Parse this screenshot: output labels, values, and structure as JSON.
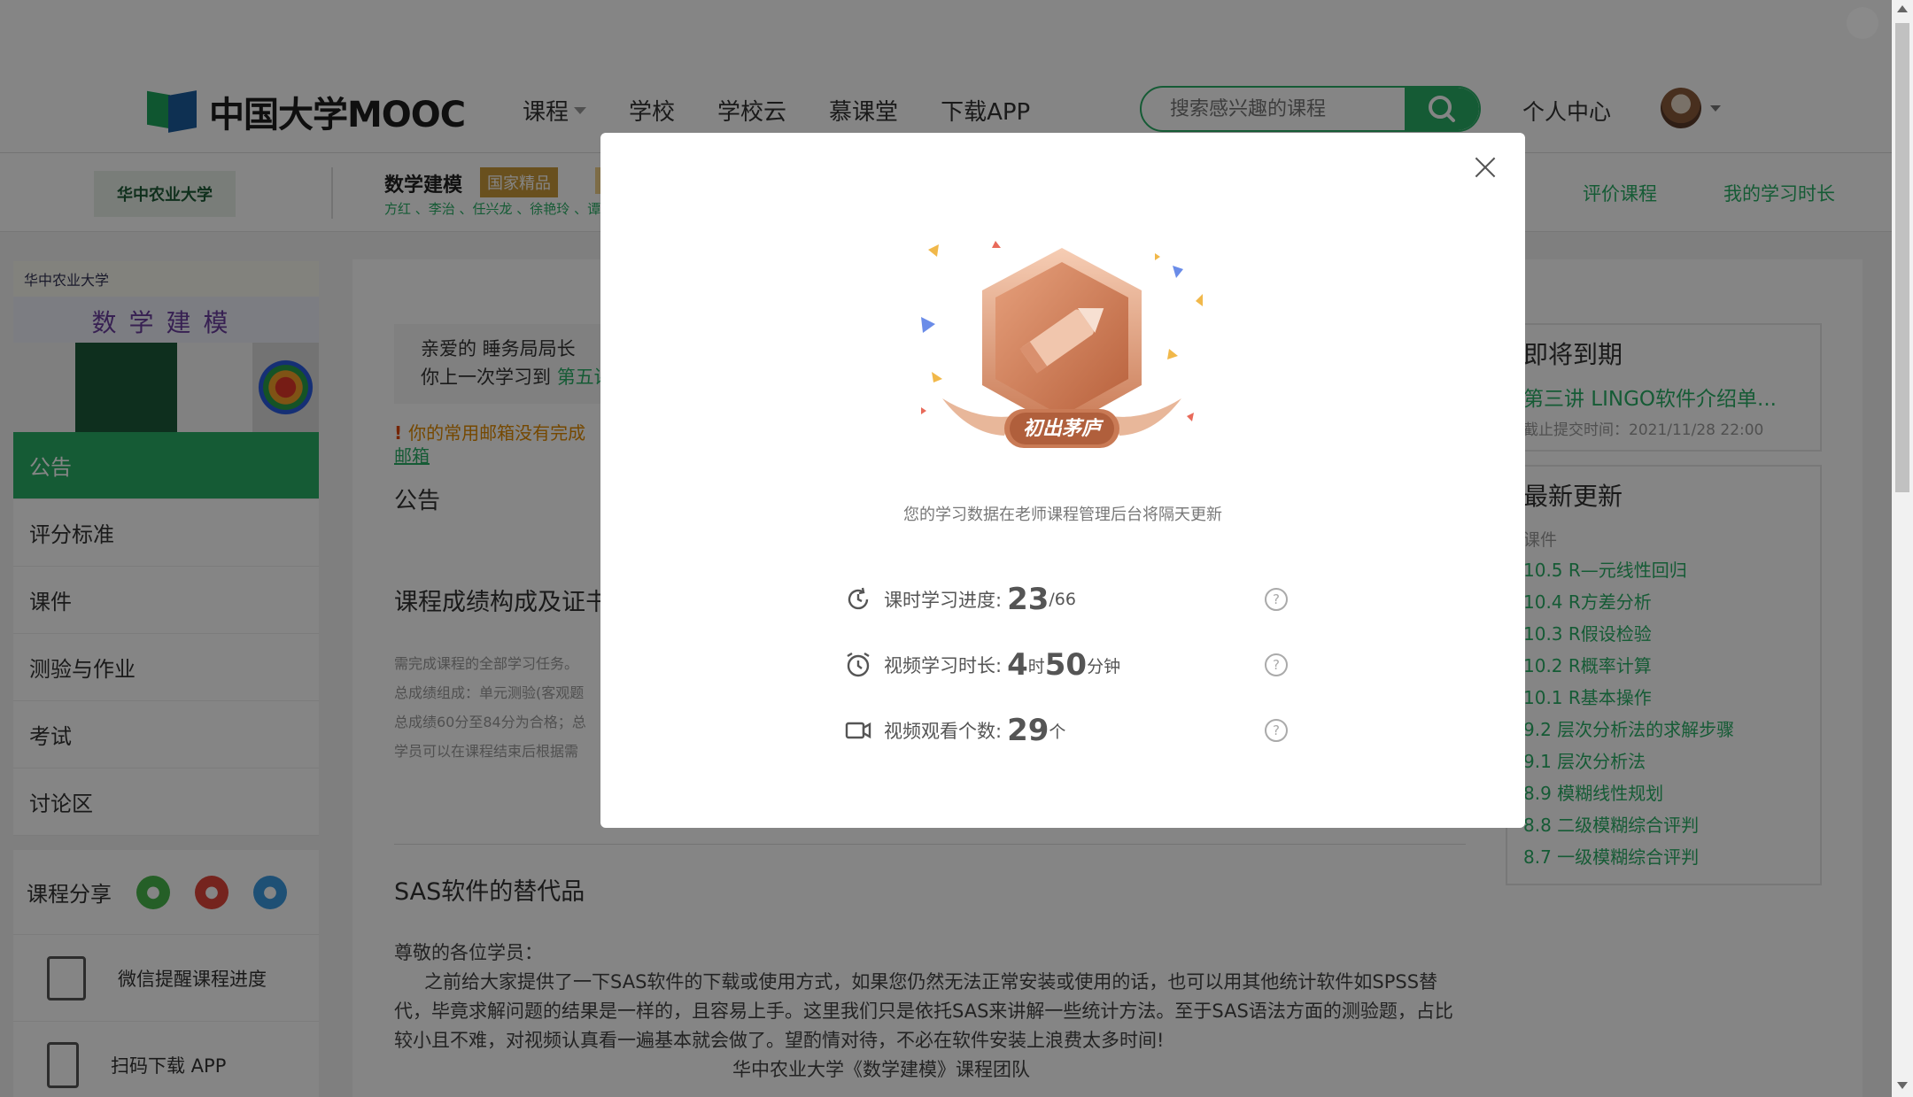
{
  "header": {
    "logo_text": "中国大学MOOC",
    "nav": [
      "课程",
      "学校",
      "学校云",
      "慕课堂",
      "下载APP"
    ],
    "search_placeholder": "搜索感兴趣的课程",
    "personal_center": "个人中心"
  },
  "course_bar": {
    "school_logo_text": "华中农业大学",
    "course_name": "数学建模",
    "badge": "国家精品",
    "teachers": "方红 、李治 、任兴龙 、徐艳玲 、谭",
    "link_rate": "评价课程",
    "link_time": "我的学习时长"
  },
  "sidebar": {
    "banner_school": "华中农业大学",
    "banner_title": "数学建模",
    "menu": [
      "公告",
      "评分标准",
      "课件",
      "测验与作业",
      "考试",
      "讨论区"
    ],
    "share_label": "课程分享",
    "tools": [
      "微信提醒课程进度",
      "扫码下载 APP"
    ]
  },
  "main": {
    "welcome_line1": "亲爱的 睡务局局长",
    "welcome_line2_prefix": "你上一次学习到",
    "welcome_line2_link": "第五讲",
    "warning": "你的常用邮箱没有完成",
    "mail_link": "邮箱",
    "section_announce": "公告",
    "section_grading": "课程成绩构成及证书",
    "rules": [
      "需完成课程的全部学习任务。",
      "总成绩组成：单元测验(客观题",
      "总成绩60分至84分为合格；总",
      "学员可以在课程结束后根据需"
    ],
    "section_sas": "SAS软件的替代品",
    "notice_greeting": "尊敬的各位学员：",
    "notice_body": "之前给大家提供了一下SAS软件的下载或使用方式，如果您仍然无法正常安装或使用的话，也可以用其他统计软件如SPSS替代，毕竟求解问题的结果是一样的，且容易上手。这里我们只是依托SAS来讲解一些统计方法。至于SAS语法方面的测验题，占比较小且不难，对视频认真看一遍基本就会做了。望酌情对待，不必在软件安装上浪费太多时间!",
    "notice_sign": "华中农业大学《数学建模》课程团队"
  },
  "right": {
    "due_title": "即将到期",
    "due_item": "第三讲 LINGO软件介绍单...",
    "due_time": "截止提交时间：2021/11/28 22:00",
    "update_title": "最新更新",
    "update_category": "课件",
    "updates": [
      "10.5 R—元线性回归",
      "10.4 R方差分析",
      "10.3 R假设检验",
      "10.2 R概率计算",
      "10.1 R基本操作",
      "9.2 层次分析法的求解步骤",
      "9.1 层次分析法",
      "8.9 模糊线性规划",
      "8.8 二级模糊综合评判",
      "8.7 一级模糊综合评判"
    ]
  },
  "modal": {
    "badge_text": "初出茅庐",
    "caption": "您的学习数据在老师课程管理后台将隔天更新",
    "progress_label": "课时学习进度:",
    "progress_done": "23",
    "progress_total": "/66",
    "duration_label": "视频学习时长:",
    "duration_hours": "4",
    "duration_h_unit": "时",
    "duration_minutes": "50",
    "duration_m_unit": "分钟",
    "videos_label": "视频观看个数:",
    "videos_count": "29",
    "videos_unit": "个",
    "help_glyph": "?"
  },
  "colors": {
    "accent": "#2aae67",
    "warning": "#e08a00",
    "badge_bronze": "#d9906e"
  }
}
